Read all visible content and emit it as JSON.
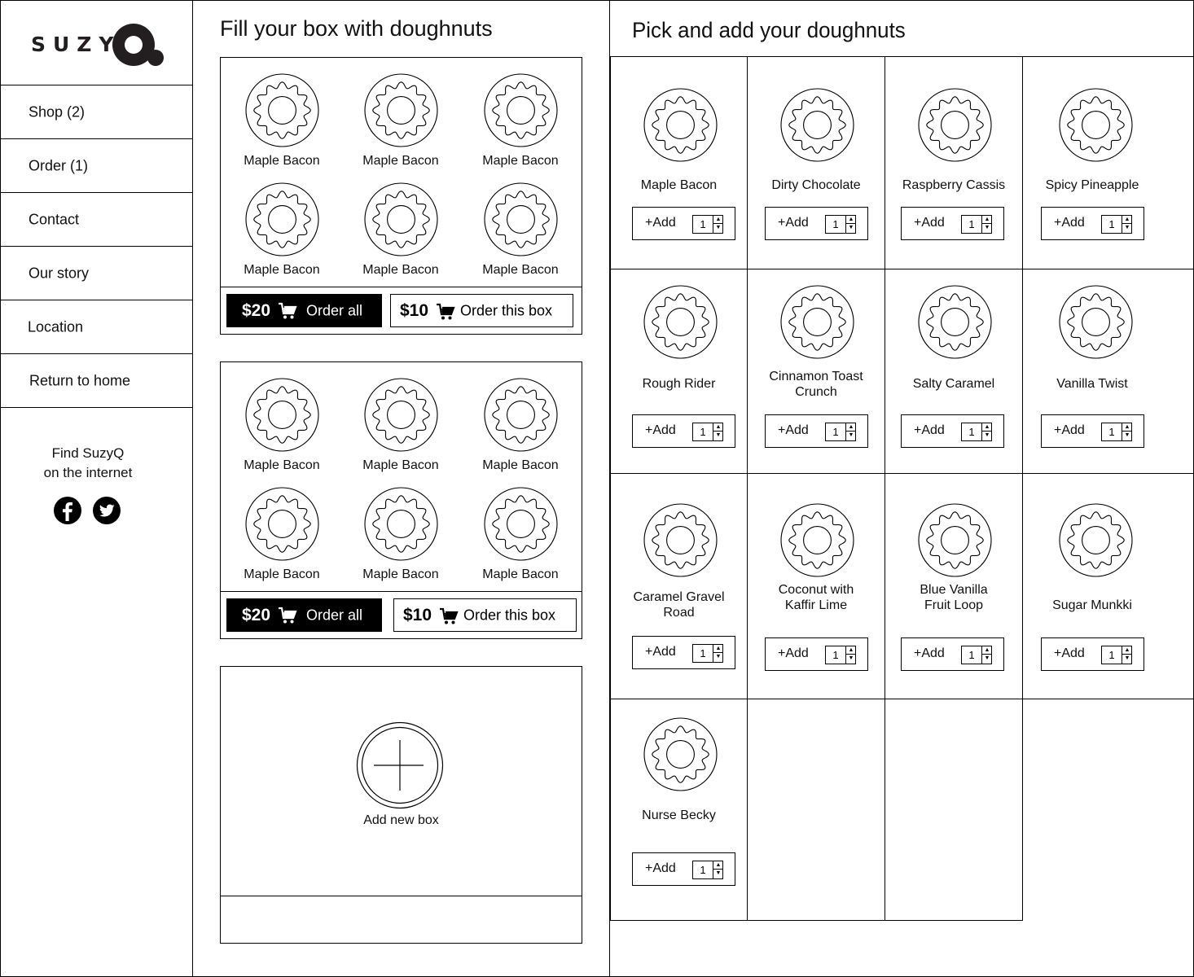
{
  "brand": {
    "name": "SUZY",
    "logo_mark": "Q"
  },
  "sidebar": {
    "items": [
      {
        "label": "Shop (2)",
        "key": "shop"
      },
      {
        "label": "Order (1)",
        "key": "order"
      },
      {
        "label": "Contact",
        "key": "contact"
      },
      {
        "label": "Our story",
        "key": "our-story"
      },
      {
        "label": "Location",
        "key": "location"
      },
      {
        "label": "Return to home",
        "key": "return-home"
      }
    ],
    "find_line1": "Find SuzyQ",
    "find_line2": "on the internet",
    "social": [
      {
        "name": "facebook-icon"
      },
      {
        "name": "twitter-icon"
      }
    ]
  },
  "boxes_section": {
    "title": "Fill your box with doughnuts",
    "boxes": [
      {
        "items": [
          "Maple Bacon",
          "Maple Bacon",
          "Maple Bacon",
          "Maple Bacon",
          "Maple Bacon",
          "Maple Bacon"
        ],
        "order_all": {
          "price": "$20",
          "label": "Order all",
          "icon": "cart-icon"
        },
        "order_box": {
          "price": "$10",
          "label": "Order this box",
          "icon": "cart-icon"
        }
      },
      {
        "items": [
          "Maple Bacon",
          "Maple Bacon",
          "Maple Bacon",
          "Maple Bacon",
          "Maple Bacon",
          "Maple Bacon"
        ],
        "order_all": {
          "price": "$20",
          "label": "Order all",
          "icon": "cart-icon"
        },
        "order_box": {
          "price": "$10",
          "label": "Order this box",
          "icon": "cart-icon"
        }
      }
    ],
    "add_new_box": {
      "label": "Add new box",
      "icon": "plus-icon"
    }
  },
  "catalog": {
    "title": "Pick and add your doughnuts",
    "add_label": "+Add",
    "items": [
      {
        "name": "Maple Bacon",
        "qty": "1"
      },
      {
        "name": "Dirty Chocolate",
        "qty": "1"
      },
      {
        "name": "Raspberry Cassis",
        "qty": "1"
      },
      {
        "name": "Spicy Pineapple",
        "qty": "1"
      },
      {
        "name": "Rough Rider",
        "qty": "1"
      },
      {
        "name": "Cinnamon Toast\nCrunch",
        "qty": "1"
      },
      {
        "name": "Salty Caramel",
        "qty": "1"
      },
      {
        "name": "Vanilla Twist",
        "qty": "1"
      },
      {
        "name": "Caramel Gravel\nRoad",
        "qty": "1"
      },
      {
        "name": "Coconut with\nKaffir Lime",
        "qty": "1"
      },
      {
        "name": "Blue Vanilla\nFruit Loop",
        "qty": "1"
      },
      {
        "name": "Sugar Munkki",
        "qty": "1"
      },
      {
        "name": "Nurse Becky",
        "qty": "1"
      }
    ],
    "spinner_up": "▲",
    "spinner_down": "▼"
  }
}
